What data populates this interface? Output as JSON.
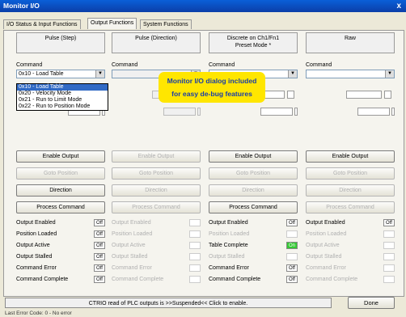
{
  "window": {
    "title": "Monitor I/O",
    "close_glyph": "x"
  },
  "tabs": [
    {
      "label": "I/O Status & Input Functions"
    },
    {
      "label": "Output Functions",
      "active": true
    },
    {
      "label": "System Functions"
    }
  ],
  "columns": [
    {
      "header": "Pulse (Step)",
      "command_label": "Command",
      "command_value": "0x10 - Load Table",
      "enabled": true,
      "buttons": [
        "Enable Output",
        "Goto Position",
        "Direction",
        "Process Command"
      ],
      "buttons_enabled": [
        true,
        false,
        true,
        true
      ],
      "status": [
        {
          "label": "Output Enabled",
          "value": "Off"
        },
        {
          "label": "Position Loaded",
          "value": "Off"
        },
        {
          "label": "Output Active",
          "value": "Off"
        },
        {
          "label": "Output Stalled",
          "value": "Off"
        },
        {
          "label": "Command Error",
          "value": "Off"
        },
        {
          "label": "Command Complete",
          "value": "Off"
        }
      ]
    },
    {
      "header": "Pulse (Direction)",
      "command_label": "Command",
      "command_value": "",
      "enabled": false,
      "buttons": [
        "Enable Output",
        "Goto Position",
        "Direction",
        "Process Command"
      ],
      "buttons_enabled": [
        false,
        false,
        false,
        false
      ],
      "status": [
        {
          "label": "Output Enabled",
          "value": ""
        },
        {
          "label": "Position Loaded",
          "value": ""
        },
        {
          "label": "Output Active",
          "value": ""
        },
        {
          "label": "Output Stalled",
          "value": ""
        },
        {
          "label": "Command Error",
          "value": ""
        },
        {
          "label": "Command Complete",
          "value": ""
        }
      ]
    },
    {
      "header": "Discrete on Ch1/Fn1\nPreset Mode *",
      "command_label": "Command",
      "command_value": "",
      "enabled": true,
      "buttons": [
        "Enable Output",
        "Goto Position",
        "Direction",
        "Process Command"
      ],
      "buttons_enabled": [
        true,
        false,
        false,
        true
      ],
      "status": [
        {
          "label": "Output Enabled",
          "value": "Off"
        },
        {
          "label": "Position Loaded",
          "value": ""
        },
        {
          "label": "Table Complete",
          "value": "On"
        },
        {
          "label": "Output Stalled",
          "value": ""
        },
        {
          "label": "Command Error",
          "value": "Off"
        },
        {
          "label": "Command Complete",
          "value": "Off"
        }
      ]
    },
    {
      "header": "Raw",
      "command_label": "Command",
      "command_value": "",
      "enabled": true,
      "buttons": [
        "Enable Output",
        "Goto Position",
        "Direction",
        "Process Command"
      ],
      "buttons_enabled": [
        true,
        false,
        false,
        false
      ],
      "status": [
        {
          "label": "Output Enabled",
          "value": "Off"
        },
        {
          "label": "Position Loaded",
          "value": ""
        },
        {
          "label": "Output Active",
          "value": ""
        },
        {
          "label": "Output Stalled",
          "value": ""
        },
        {
          "label": "Command Error",
          "value": ""
        },
        {
          "label": "Command Complete",
          "value": ""
        }
      ]
    }
  ],
  "dropdown_options": [
    "0x10 - Load Table",
    "0x20 - Velocity Mode",
    "0x21 - Run to Limit Mode",
    "0x22 - Run to Position Mode"
  ],
  "callout": {
    "line1": "Monitor I/O dialog included",
    "line2": "for easy de-bug features"
  },
  "statusbar": {
    "text": "CTRIO read of PLC outputs is >>Suspended<< Click to enable."
  },
  "done_label": "Done",
  "last_error": "Last Error Code: 0 - No error",
  "colors": {
    "title_bar": "#0b4fc0",
    "callout_bg": "#ffe600",
    "callout_text": "#1a3ea8",
    "on_indicator": "#34c834"
  }
}
